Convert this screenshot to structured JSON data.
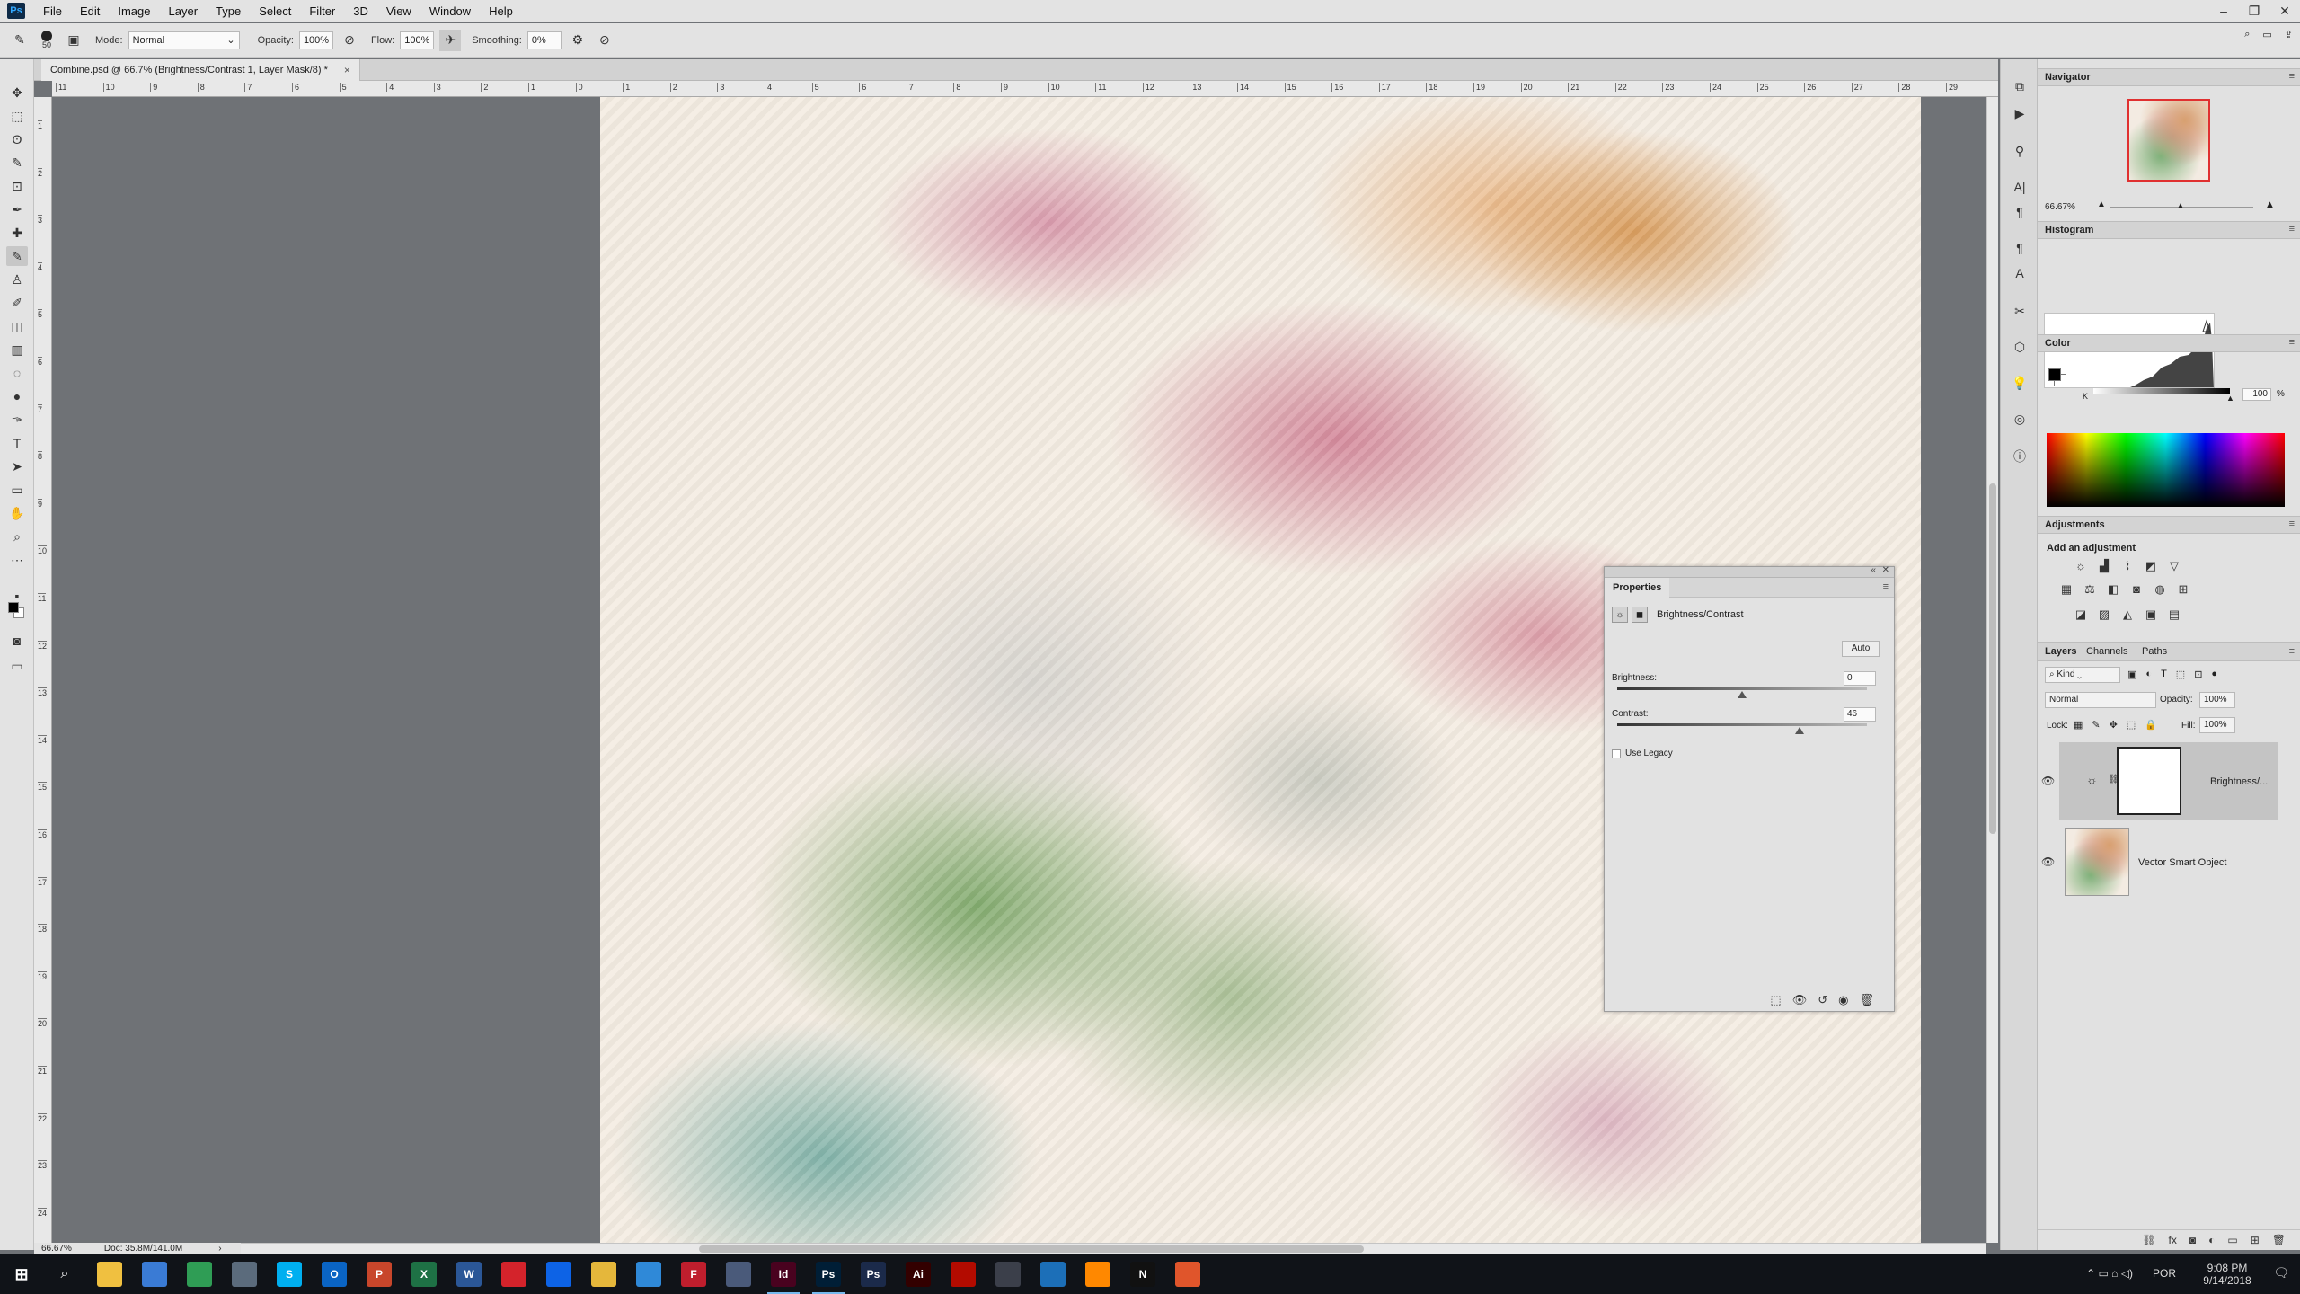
{
  "menu": {
    "app_icon": "Ps",
    "items": [
      "File",
      "Edit",
      "Image",
      "Layer",
      "Type",
      "Select",
      "Filter",
      "3D",
      "View",
      "Window",
      "Help"
    ],
    "window_controls": [
      "minimize-icon",
      "restore-icon",
      "close-icon"
    ]
  },
  "options_bar": {
    "brush_size": "50",
    "mode_label": "Mode:",
    "mode_value": "Normal",
    "opacity_label": "Opacity:",
    "opacity_value": "100%",
    "flow_label": "Flow:",
    "flow_value": "100%",
    "smoothing_label": "Smoothing:",
    "smoothing_value": "0%"
  },
  "document": {
    "tab_title": "Combine.psd @ 66.7% (Brightness/Contrast 1, Layer Mask/8) *",
    "zoom": "66.67%",
    "doc_info": "Doc: 35.8M/141.0M"
  },
  "rulers": {
    "top": [
      "11",
      "10",
      "9",
      "8",
      "7",
      "6",
      "5",
      "4",
      "3",
      "2",
      "1",
      "0",
      "1",
      "2",
      "3",
      "4",
      "5",
      "6",
      "7",
      "8",
      "9",
      "10",
      "11",
      "12",
      "13",
      "14",
      "15",
      "16",
      "17",
      "18",
      "19",
      "20",
      "21",
      "22",
      "23",
      "24",
      "25",
      "26",
      "27",
      "28",
      "29"
    ],
    "left": [
      "1",
      "2",
      "3",
      "4",
      "5",
      "6",
      "7",
      "8",
      "9",
      "10",
      "11",
      "12",
      "13",
      "14",
      "15",
      "16",
      "17",
      "18",
      "19",
      "20",
      "21",
      "22",
      "23",
      "24"
    ]
  },
  "properties": {
    "tab": "Properties",
    "title": "Brightness/Contrast",
    "auto_label": "Auto",
    "brightness_label": "Brightness:",
    "brightness_value": "0",
    "brightness_pct": 0.5,
    "contrast_label": "Contrast:",
    "contrast_value": "46",
    "contrast_pct": 0.73,
    "legacy_label": "Use Legacy"
  },
  "navigator": {
    "title": "Navigator",
    "zoom": "66.67%"
  },
  "histogram": {
    "title": "Histogram"
  },
  "color": {
    "title": "Color",
    "channel": "K",
    "value": "100",
    "unit": "%"
  },
  "adjustments": {
    "title": "Adjustments",
    "subtitle": "Add an adjustment"
  },
  "layers": {
    "tabs": [
      "Layers",
      "Channels",
      "Paths"
    ],
    "filter": "Kind",
    "blend_mode": "Normal",
    "opacity_label": "Opacity:",
    "opacity_value": "100%",
    "lock_label": "Lock:",
    "fill_label": "Fill:",
    "fill_value": "100%",
    "items": [
      {
        "name": "Brightness/...",
        "selected": true
      },
      {
        "name": "Vector Smart Object",
        "selected": false
      }
    ]
  },
  "taskbar": {
    "time": "9:08 PM",
    "date": "9/14/2018",
    "lang": "POR",
    "apps": [
      {
        "name": "file-explorer-icon",
        "label": "",
        "color": "#f0c040"
      },
      {
        "name": "store-icon",
        "label": "",
        "color": "#3a7bd5"
      },
      {
        "name": "chrome-icon",
        "label": "",
        "color": "#2f9d55"
      },
      {
        "name": "mail-icon",
        "label": "",
        "color": "#5b6b7c"
      },
      {
        "name": "skype-icon",
        "label": "S",
        "color": "#00aff0"
      },
      {
        "name": "outlook-icon",
        "label": "O",
        "color": "#0a64c4"
      },
      {
        "name": "powerpoint-icon",
        "label": "P",
        "color": "#c8462b"
      },
      {
        "name": "excel-icon",
        "label": "X",
        "color": "#1e7145"
      },
      {
        "name": "word-icon",
        "label": "W",
        "color": "#2b5797"
      },
      {
        "name": "acrobat-dc-icon",
        "label": "",
        "color": "#d4232b"
      },
      {
        "name": "dropbox-icon",
        "label": "",
        "color": "#0d63e6"
      },
      {
        "name": "folder-icon",
        "label": "",
        "color": "#e5b73b"
      },
      {
        "name": "onedrive-icon",
        "label": "",
        "color": "#2f89d8"
      },
      {
        "name": "filezilla-icon",
        "label": "F",
        "color": "#bf1e2d"
      },
      {
        "name": "app-icon",
        "label": "",
        "color": "#4a5a7a"
      },
      {
        "name": "indesign-icon",
        "label": "Id",
        "color": "#49021f"
      },
      {
        "name": "photoshop-icon",
        "label": "Ps",
        "color": "#001e36"
      },
      {
        "name": "photoshop-alt-icon",
        "label": "Ps",
        "color": "#1b2a4a"
      },
      {
        "name": "illustrator-icon",
        "label": "Ai",
        "color": "#330000"
      },
      {
        "name": "acrobat-icon",
        "label": "",
        "color": "#b30b00"
      },
      {
        "name": "app2-icon",
        "label": "",
        "color": "#3b3f4a"
      },
      {
        "name": "app3-icon",
        "label": "",
        "color": "#1c6fb8"
      },
      {
        "name": "vlc-icon",
        "label": "",
        "color": "#ff8800"
      },
      {
        "name": "netflix-icon",
        "label": "N",
        "color": "#111111"
      },
      {
        "name": "app4-icon",
        "label": "",
        "color": "#e0552b"
      }
    ]
  },
  "colors": {
    "accent": "#31a8ff",
    "selection": "#c4c4c4"
  }
}
